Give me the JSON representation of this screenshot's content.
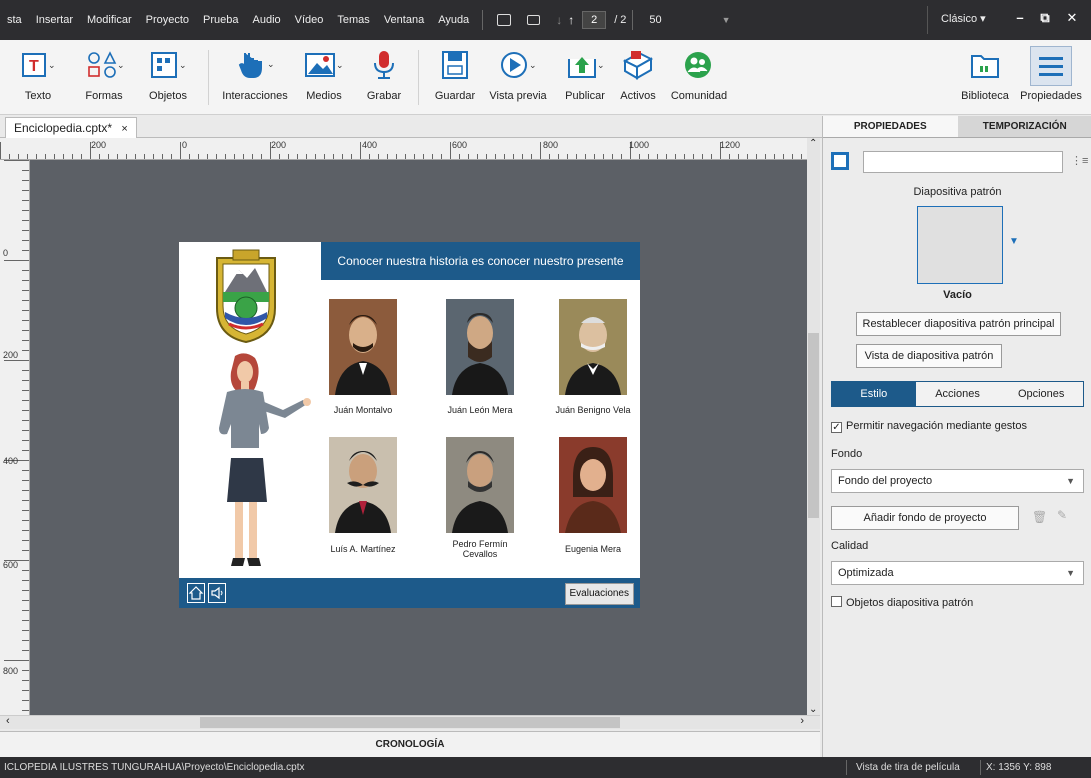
{
  "menubar": {
    "items": [
      "sta",
      "Insertar",
      "Modificar",
      "Proyecto",
      "Prueba",
      "Audio",
      "Vídeo",
      "Temas",
      "Ventana",
      "Ayuda"
    ],
    "current_page": "2",
    "page_total": "/ 2",
    "zoom": "50",
    "workspace": "Clásico"
  },
  "toolbar": {
    "texto": "Texto",
    "formas": "Formas",
    "objetos": "Objetos",
    "interacciones": "Interacciones",
    "medios": "Medios",
    "grabar": "Grabar",
    "guardar": "Guardar",
    "vista_previa": "Vista previa",
    "publicar": "Publicar",
    "activos": "Activos",
    "comunidad": "Comunidad",
    "biblioteca": "Biblioteca",
    "propiedades": "Propiedades"
  },
  "doc_tab": {
    "filename": "Enciclopedia.cptx*",
    "close": "×"
  },
  "rulers": {
    "top": [
      "200",
      "0",
      "200",
      "400",
      "600",
      "800",
      "1000",
      "1200"
    ],
    "left": [
      "0",
      "200",
      "400",
      "600",
      "800"
    ]
  },
  "slide": {
    "banner": "Conocer nuestra historia es conocer nuestro presente",
    "people": [
      {
        "name": "Juán Montalvo"
      },
      {
        "name": "Juán León Mera"
      },
      {
        "name": "Juán Benigno Vela"
      },
      {
        "name": "Luís A. Martínez"
      },
      {
        "name": "Pedro Fermín Cevallos"
      },
      {
        "name": "Eugenia Mera"
      }
    ],
    "eval_button": "Evaluaciones"
  },
  "timeline_label": "CRONOLOGÍA",
  "panel": {
    "tab_props": "PROPIEDADES",
    "tab_timing": "TEMPORIZACIÓN",
    "name_value": "",
    "master_label": "Diapositiva patrón",
    "master_name": "Vacío",
    "reset_master": "Restablecer diapositiva patrón principal",
    "view_master": "Vista de diapositiva patrón",
    "subtabs": [
      "Estilo",
      "Acciones",
      "Opciones"
    ],
    "allow_gestures": "Permitir navegación mediante gestos",
    "fondo_label": "Fondo",
    "fondo_value": "Fondo del proyecto",
    "add_bg": "Añadir fondo de proyecto",
    "calidad_label": "Calidad",
    "calidad_value": "Optimizada",
    "master_objects": "Objetos diapositiva patrón",
    "colors": {
      "accent": "#1d5a8a",
      "chrome": "#2d2d30",
      "canvas": "#5c6066"
    }
  },
  "status": {
    "path": "ICLOPEDIA ILUSTRES TUNGURAHUA\\Proyecto\\Enciclopedia.cptx",
    "filmstrip": "Vista de tira de película",
    "coords": "X: 1356 Y: 898"
  }
}
